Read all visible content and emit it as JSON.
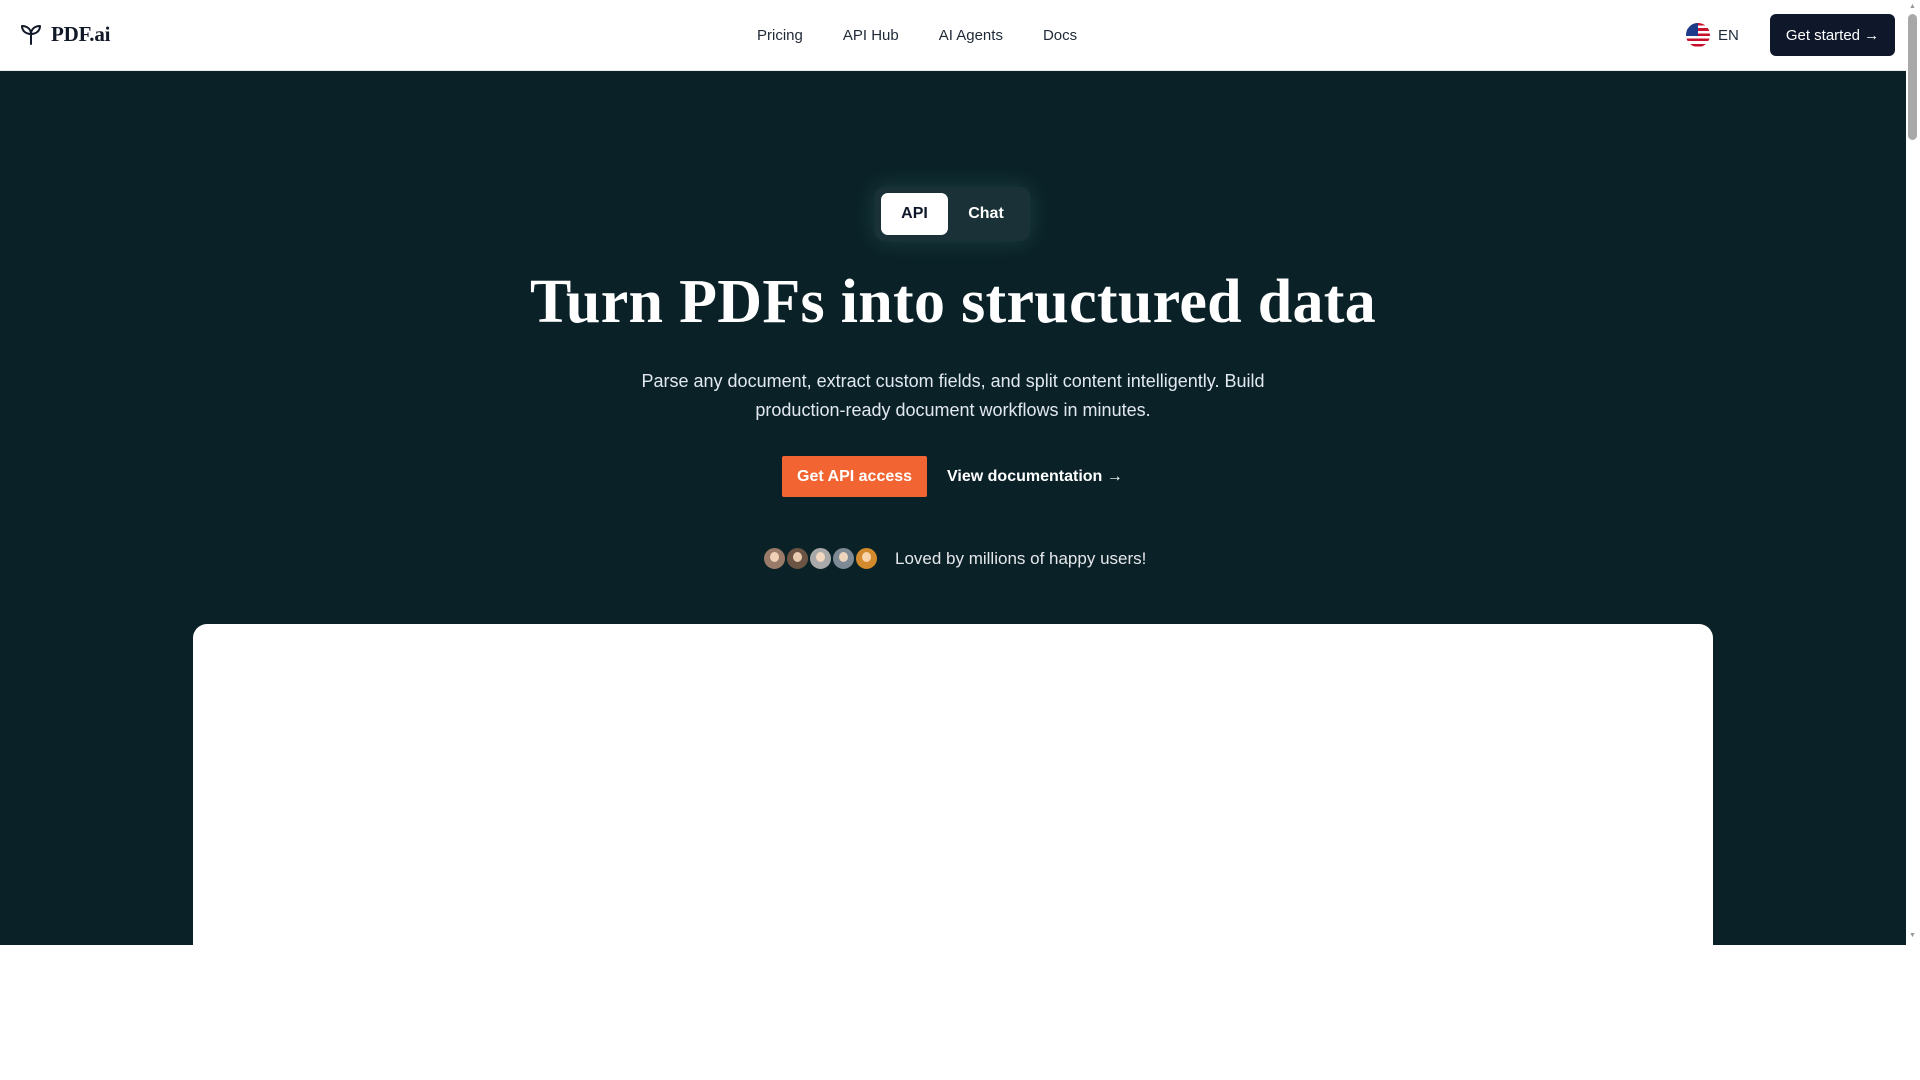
{
  "nav": {
    "logo_text": "PDF.ai",
    "links": [
      "Pricing",
      "API Hub",
      "AI Agents",
      "Docs"
    ],
    "language": "EN",
    "cta_label": "Get started →"
  },
  "hero": {
    "toggle": {
      "active": "API",
      "inactive": "Chat"
    },
    "title": "Turn PDFs into structured data",
    "subtitle": "Parse any document, extract custom fields, and split content intelligently. Build production-ready document workflows in minutes.",
    "primary_cta": "Get API access",
    "secondary_cta": "View documentation →",
    "social_proof": "Loved by millions of happy users!"
  },
  "colors": {
    "hero_bg": "#0a2227",
    "accent": "#f26532",
    "nav_button": "#0f172a"
  },
  "icons": [
    "logo-sprout-icon",
    "us-flag-icon",
    "user-avatar"
  ]
}
